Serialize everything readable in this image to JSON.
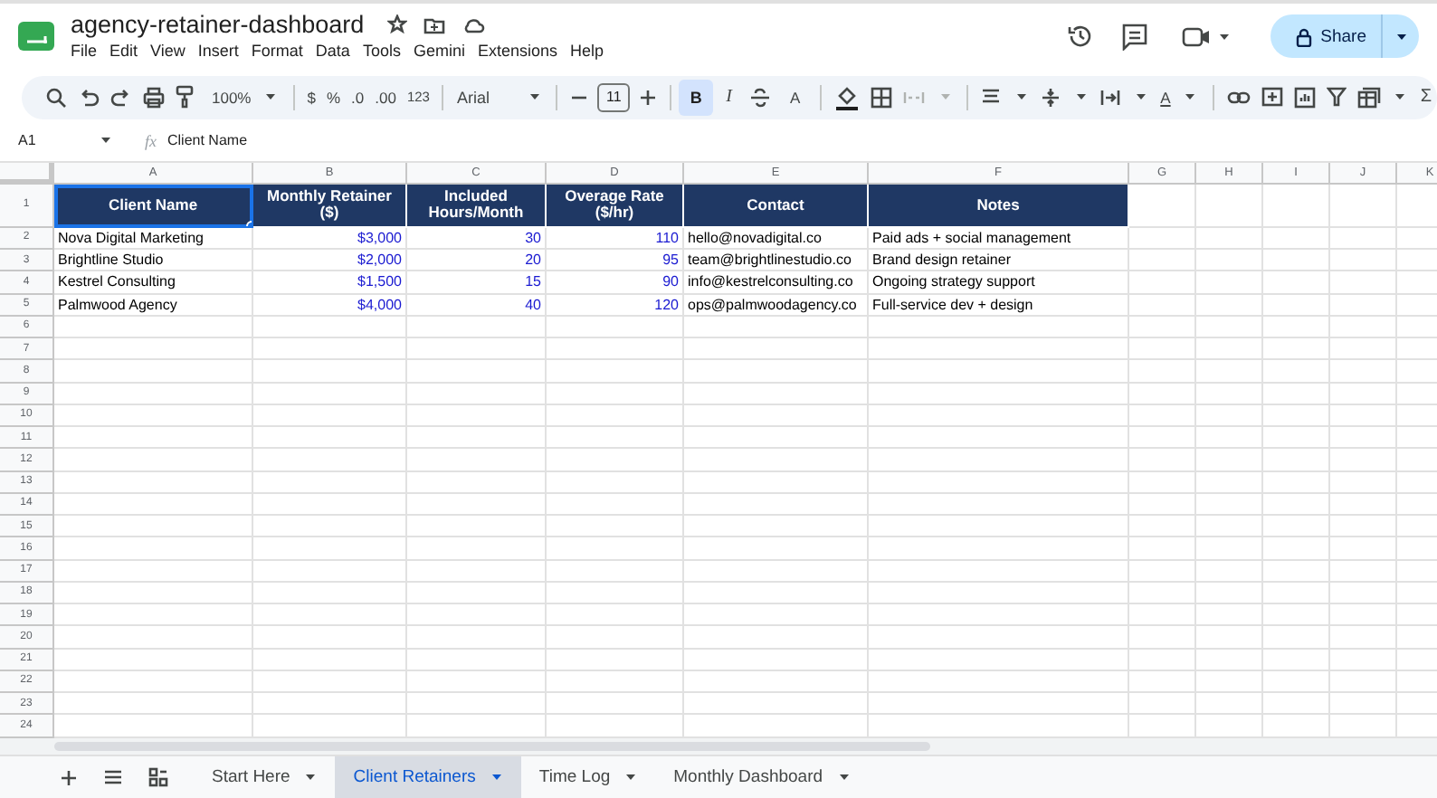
{
  "document": {
    "title": "agency-retainer-dashboard"
  },
  "menus": [
    "File",
    "Edit",
    "View",
    "Insert",
    "Format",
    "Data",
    "Tools",
    "Gemini",
    "Extensions",
    "Help"
  ],
  "share_button": {
    "label": "Share"
  },
  "toolbar": {
    "zoom": "100%",
    "currency": "$",
    "percent": "%",
    "decrease_decimals": ".0",
    "increase_decimals": ".00",
    "number_format": "123",
    "font": "Arial",
    "font_size": "11",
    "bold": {
      "label": "B",
      "selected": true
    },
    "italic": "I",
    "text_color": "A",
    "text_rotation": "A",
    "sum": "Σ"
  },
  "formula_bar": {
    "cell_reference": "A1",
    "fx": "fx",
    "formula": "Client Name"
  },
  "sheet": {
    "column_letters": [
      "A",
      "B",
      "C",
      "D",
      "E",
      "F",
      "G",
      "H",
      "I",
      "J",
      "K"
    ],
    "header_row": [
      {
        "text": "Client Name",
        "kind": "text",
        "selected": true
      },
      {
        "text": "Monthly Retainer ($)",
        "kind": "number",
        "selected": false
      },
      {
        "text": "Included Hours/Month",
        "kind": "number",
        "selected": false
      },
      {
        "text": "Overage Rate ($/hr)",
        "kind": "number",
        "selected": false
      },
      {
        "text": "Contact",
        "kind": "text",
        "selected": false
      },
      {
        "text": "Notes",
        "kind": "text",
        "selected": false
      }
    ],
    "rows": [
      [
        "Nova Digital Marketing",
        "$3,000",
        "30",
        "110",
        "hello@novadigital.co",
        "Paid ads + social management"
      ],
      [
        "Brightline Studio",
        "$2,000",
        "20",
        "95",
        "team@brightlinestudio.co",
        "Brand design retainer"
      ],
      [
        "Kestrel Consulting",
        "$1,500",
        "15",
        "90",
        "info@kestrelconsulting.co",
        "Ongoing strategy support"
      ],
      [
        "Palmwood Agency",
        "$4,000",
        "40",
        "120",
        "ops@palmwoodagency.co",
        "Full-service dev + design"
      ]
    ],
    "row_numbers": [
      "1",
      "2",
      "3",
      "4",
      "5",
      "6",
      "7",
      "8",
      "9",
      "10",
      "11",
      "12",
      "13",
      "14",
      "15",
      "16",
      "17",
      "18",
      "19",
      "20",
      "21",
      "22",
      "23",
      "24"
    ]
  },
  "sheet_tabs": [
    {
      "label": "Start Here",
      "selected": false
    },
    {
      "label": "Client Retainers",
      "selected": true
    },
    {
      "label": "Time Log",
      "selected": false
    },
    {
      "label": "Monthly Dashboard",
      "selected": false
    }
  ]
}
